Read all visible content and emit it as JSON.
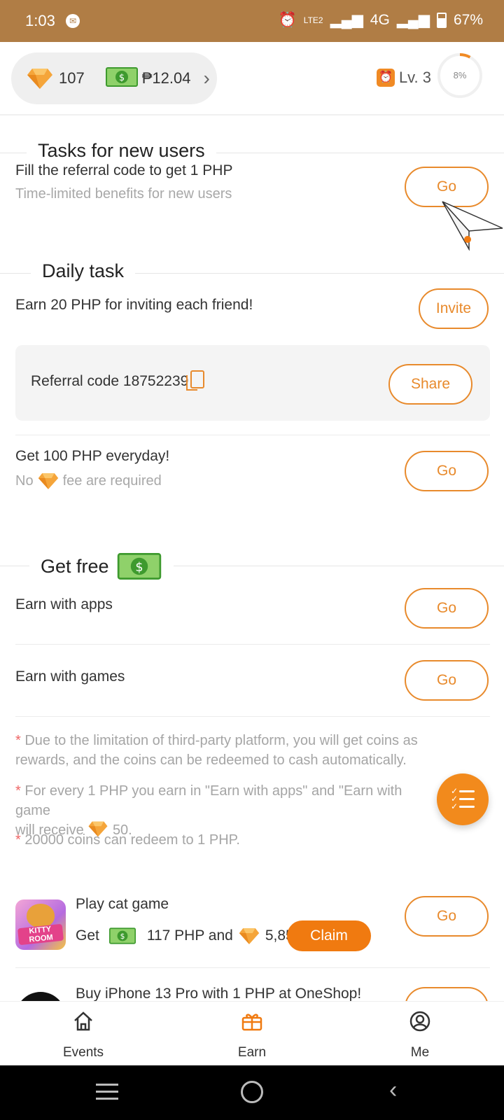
{
  "status_bar": {
    "time": "1:03",
    "network": "4G",
    "lte": "LTE2",
    "battery": "67%"
  },
  "header": {
    "gem_count": "107",
    "cash_amount": "₱12.04",
    "level": "Lv. 3",
    "progress_percent": "8%",
    "progress_value": 0.08,
    "accent_color": "#f08a24"
  },
  "sections": {
    "new_users": {
      "title": "Tasks for new users",
      "task_title": "Fill the referral code to get 1 PHP",
      "task_sub": "Time-limited benefits for new users",
      "button": "Go"
    },
    "daily": {
      "title": "Daily task",
      "invite_text": "Earn 20 PHP for inviting each friend!",
      "invite_button": "Invite",
      "referral_label": "Referral code 18752239",
      "share_button": "Share",
      "everyday_title": "Get 100 PHP everyday!",
      "everyday_sub_pre": "No",
      "everyday_sub_post": "fee are required",
      "everyday_button": "Go"
    },
    "free": {
      "title": "Get free",
      "apps_label": "Earn with apps",
      "apps_button": "Go",
      "games_label": "Earn with games",
      "games_button": "Go"
    }
  },
  "notes": {
    "note1": "Due to the limitation of third-party platform, you will get coins as rewards, and the coins can be redeemed to cash automatically.",
    "note2_pre": "For every 1 PHP you earn in \"Earn with apps\" and \"Earn with game",
    "note2_line2_pre": "will receive",
    "note2_line2_post": "50.",
    "note3": "20000 coins can redeem to 1 PHP.",
    "star": "*"
  },
  "offers": {
    "cat_game": {
      "title": "Play cat game",
      "get": "Get",
      "php": "117 PHP and",
      "coins": "5,850",
      "claim": "Claim",
      "button": "Go",
      "icon_text": "KITTY ROOM"
    },
    "oneshop": {
      "title": "Buy iPhone 13 Pro with 1 PHP at OneShop!"
    }
  },
  "bottom_nav": {
    "events": "Events",
    "earn": "Earn",
    "me": "Me"
  }
}
